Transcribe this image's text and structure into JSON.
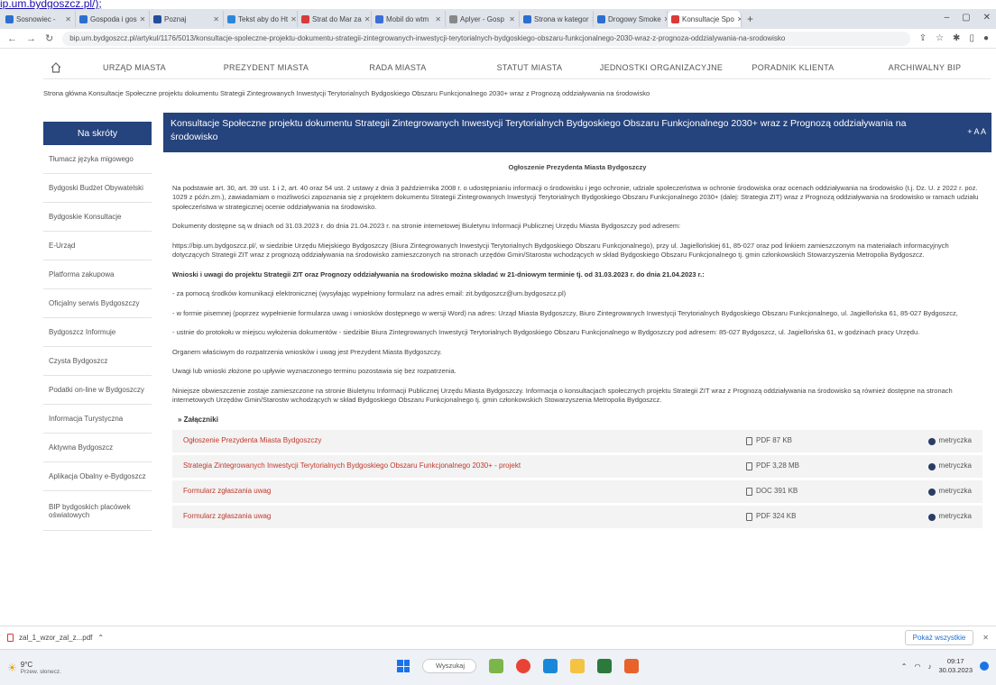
{
  "top_link": "ip.um.bydgoszcz.pl/);",
  "browser": {
    "tabs": [
      {
        "label": "Sosnowiec -",
        "color": "#2b6fd1"
      },
      {
        "label": "Gospoda i gos",
        "color": "#2b6fd1"
      },
      {
        "label": "Poznaj",
        "color": "#244e9c"
      },
      {
        "label": "Tekst aby do Ht",
        "color": "#2d87d8"
      },
      {
        "label": "Strat do Mar za",
        "color": "#d93a3a"
      },
      {
        "label": "Mobil do wtm",
        "color": "#3a6fd8"
      },
      {
        "label": "Aplyer - Gosp",
        "color": "#888888"
      },
      {
        "label": "Strona w kategor",
        "color": "#2b6fd1"
      },
      {
        "label": "Drogowy Smoke",
        "color": "#2b6fd1"
      },
      {
        "label": "Konsultacje Spo",
        "color": "#d93a3a"
      }
    ],
    "active_tab": 9,
    "url": "bip.um.bydgoszcz.pl/artykul/1176/5013/konsultacje-spoleczne-projektu-dokumentu-strategii-zintegrowanych-inwestycji-terytorialnych-bydgoskiego-obszaru-funkcjonalnego-2030-wraz-z-prognoza-oddzialywania-na-srodowisko"
  },
  "site_nav": [
    "URZĄD MIASTA",
    "PREZYDENT MIASTA",
    "RADA MIASTA",
    "STATUT MIASTA",
    "JEDNOSTKI ORGANIZACYJNE",
    "PORADNIK KLIENTA",
    "ARCHIWALNY BIP"
  ],
  "breadcrumb": "Strona główna  Konsultacje Społeczne projektu dokumentu Strategii Zintegrowanych Inwestycji Terytorialnych Bydgoskiego Obszaru Funkcjonalnego 2030+ wraz z Prognozą oddziaływania na środowisko",
  "sidebar": {
    "title": "Na skróty",
    "items": [
      "Tłumacz języka migowego",
      "Bydgoski Budżet Obywatelski",
      "Bydgoskie Konsultacje",
      "E-Urząd",
      "Platforma zakupowa",
      "Oficjalny serwis Bydgoszczy",
      "Bydgoszcz Informuje",
      "Czysta Bydgoszcz",
      "Podatki on-line w Bydgoszczy",
      "Informacja Turystyczna",
      "Aktywna Bydgoszcz",
      "Aplikacja Obalny e-Bydgoszcz",
      "BIP bydgoskich placówek oświatowych"
    ]
  },
  "main": {
    "title": "Konsultacje Społeczne projektu dokumentu Strategii Zintegrowanych Inwestycji Terytorialnych Bydgoskiego Obszaru Funkcjonalnego 2030+ wraz z Prognozą oddziaływania na środowisko",
    "font_controls": "+ A A",
    "announcement": "Ogłoszenie Prezydenta Miasta Bydgoszczy",
    "paragraphs": [
      "Na podstawie art. 30, art. 39 ust. 1 i 2, art. 40 oraz 54 ust. 2 ustawy z dnia 3 października 2008 r. o udostępnianiu informacji o środowisku i jego ochronie, udziale społeczeństwa w ochronie środowiska oraz ocenach oddziaływania na środowisko (t.j. Dz. U. z 2022 r. poz. 1029 z późn.zm.), zawiadamiam o możliwości zapoznania się z projektem dokumentu Strategii Zintegrowanych Inwestycji Terytorialnych Bydgoskiego Obszaru Funkcjonalnego 2030+ (dalej: Strategia ZIT) wraz z Prognozą oddziaływania na środowisko w ramach udziału społeczeństwa w strategicznej ocenie oddziaływania na środowisko.",
      "Dokumenty dostępne są w dniach od 31.03.2023 r. do dnia 21.04.2023 r. na stronie internetowej Biuletynu Informacji Publicznej Urzędu Miasta Bydgoszczy pod adresem:",
      "https://bip.um.bydgoszcz.pl/, w siedzibie Urzędu Miejskiego Bydgoszczy (Biura Zintegrowanych Inwestycji Terytorialnych Bydgoskiego Obszaru Funkcjonalnego), przy ul. Jagiellońskiej 61, 85-027 oraz pod linkiem zamieszczonym na materiałach informacyjnych dotyczących Strategii ZIT wraz z prognozą oddziaływania na środowisko zamieszczonych na stronach urzędów Gmin/Starostw wchodzących w skład Bydgoskiego Obszaru Funkcjonalnego tj. gmin członkowskich Stowarzyszenia Metropolia Bydgoszcz.",
      "Wnioski i uwagi do projektu Strategii ZIT oraz Prognozy oddziaływania na środowisko można składać w 21-dniowym terminie tj. od 31.03.2023 r. do dnia 21.04.2023 r.:",
      "- za pomocą środków komunikacji elektronicznej (wysyłając wypełniony formularz na adres email: zit.bydgoszcz@um.bydgoszcz.pl)",
      "- w formie pisemnej (poprzez wypełnienie formularza uwag i wniosków dostępnego w wersji Word) na adres: Urząd Miasta Bydgoszczy, Biuro Zintegrowanych Inwestycji Terytorialnych Bydgoskiego Obszaru Funkcjonalnego, ul. Jagiellońska 61, 85-027 Bydgoszcz,",
      "- ustnie do protokołu w miejscu wyłożenia dokumentów - siedzibie Biura Zintegrowanych Inwestycji Terytorialnych Bydgoskiego Obszaru Funkcjonalnego w Bydgoszczy pod adresem: 85-027 Bydgoszcz, ul. Jagiellońska 61, w godzinach pracy Urzędu.",
      "Organem właściwym do rozpatrzenia wniosków i uwag jest Prezydent Miasta Bydgoszczy.",
      "Uwagi lub wnioski złożone po upływie wyznaczonego terminu pozostawia się bez rozpatrzenia.",
      "Niniejsze obwieszczenie zostaje zamieszczone na stronie Biuletynu Informacji Publicznej Urzędu Miasta Bydgoszczy. Informacja o konsultacjach społecznych projektu Strategii ZIT wraz z Prognozą oddziaływania na środowisko są również dostępne na stronach internetowych Urzędów Gmin/Starostw wchodzących w skład Bydgoskiego Obszaru Funkcjonalnego tj. gmin członkowskich Stowarzyszenia Metropolia Bydgoszcz."
    ],
    "attachments_label": "» Załączniki",
    "attachments": [
      {
        "name": "Ogłoszenie Prezydenta Miasta Bydgoszczy",
        "file": "PDF 87 KB",
        "meta": "metryczka"
      },
      {
        "name": "Strategia Zintegrowanych Inwestycji Terytorialnych Bydgoskiego Obszaru Funkcjonalnego 2030+ - projekt",
        "file": "PDF 3,28 MB",
        "meta": "metryczka"
      },
      {
        "name": "Formularz zgłaszania uwag",
        "file": "DOC 391 KB",
        "meta": "metryczka"
      },
      {
        "name": "Formularz zgłaszania uwag",
        "file": "PDF 324 KB",
        "meta": "metryczka"
      }
    ]
  },
  "downloads": {
    "file": "zal_1_wzor_zal_z...pdf",
    "show_all": "Pokaż wszystkie"
  },
  "taskbar": {
    "weather_temp": "9°C",
    "weather_desc": "Przew. słonecz.",
    "search": "Wyszukaj",
    "time": "09:17",
    "date": "30.03.2023"
  }
}
